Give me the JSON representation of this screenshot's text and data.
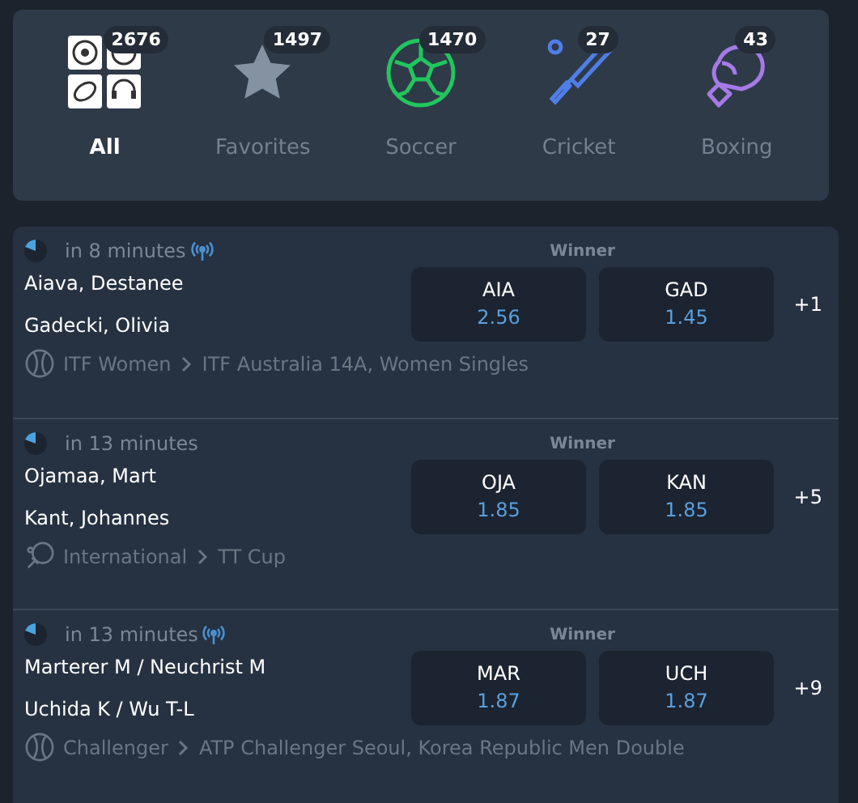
{
  "categories": [
    {
      "kind": "all",
      "label": "All",
      "count": "2676",
      "selected": true
    },
    {
      "kind": "favorites",
      "label": "Favorites",
      "count": "1497",
      "selected": false
    },
    {
      "kind": "soccer",
      "label": "Soccer",
      "count": "1470",
      "selected": false
    },
    {
      "kind": "cricket",
      "label": "Cricket",
      "count": "27",
      "selected": false
    },
    {
      "kind": "boxing",
      "label": "Boxing",
      "count": "43",
      "selected": false
    }
  ],
  "matches": [
    {
      "time": "in 8 minutes",
      "live_stream": true,
      "market": "Winner",
      "players": [
        "Aiava, Destanee",
        "Gadecki, Olivia"
      ],
      "odds": [
        {
          "code": "AIA",
          "price": "2.56"
        },
        {
          "code": "GAD",
          "price": "1.45"
        }
      ],
      "more": "+1",
      "kind": "tennis",
      "league": "ITF Women",
      "tournament": "ITF Australia 14A, Women Singles"
    },
    {
      "time": "in 13 minutes",
      "live_stream": false,
      "market": "Winner",
      "players": [
        "Ojamaa, Mart",
        "Kant, Johannes"
      ],
      "odds": [
        {
          "code": "OJA",
          "price": "1.85"
        },
        {
          "code": "KAN",
          "price": "1.85"
        }
      ],
      "more": "+5",
      "kind": "table_tennis",
      "league": "International",
      "tournament": "TT Cup"
    },
    {
      "time": "in 13 minutes",
      "live_stream": true,
      "market": "Winner",
      "players": [
        "Marterer M / Neuchrist M",
        "Uchida K / Wu T-L"
      ],
      "odds": [
        {
          "code": "MAR",
          "price": "1.87"
        },
        {
          "code": "UCH",
          "price": "1.87"
        }
      ],
      "more": "+9",
      "kind": "tennis",
      "league": "Challenger",
      "tournament": "ATP Challenger Seoul, Korea Republic Men Double"
    }
  ]
}
